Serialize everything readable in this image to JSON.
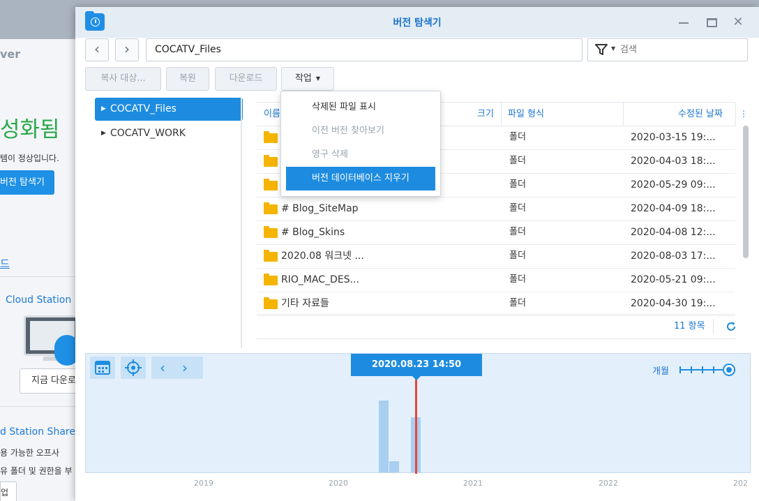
{
  "background_app": {
    "logo_fragment": "ver",
    "status": "성화됨",
    "description": "템이 정상입니다.",
    "open_button": "버전 탐색기",
    "link": "드",
    "cloud_station_title": "Cloud Station",
    "download_button": "지금 다운로",
    "share_title": "d Station Share",
    "share_desc1": "용 가능한 오프사",
    "share_desc2": "유 폴더 및 권한을 부",
    "share_button": "업"
  },
  "window": {
    "title": "버전 탐색기"
  },
  "toolbar": {
    "path": "COCATV_Files",
    "search_placeholder": "검색",
    "copy_to": "복사 대상...",
    "restore": "복원",
    "download": "다운로드",
    "action": "작업"
  },
  "tree": {
    "items": [
      {
        "label": "COCATV_Files",
        "selected": true
      },
      {
        "label": "COCATV_WORK",
        "selected": false
      }
    ]
  },
  "table": {
    "headers": {
      "name": "이름",
      "size": "크기",
      "type": "파일 형식",
      "date": "수정된 날짜"
    },
    "rows": [
      {
        "name": "",
        "type": "폴더",
        "date": "2020-03-15 19:..."
      },
      {
        "name": "",
        "type": "폴더",
        "date": "2020-04-03 18:..."
      },
      {
        "name": "",
        "type": "폴더",
        "date": "2020-05-29 09:..."
      },
      {
        "name": "# Blog_SiteMap",
        "type": "폴더",
        "date": "2020-04-09 18:..."
      },
      {
        "name": "# Blog_Skins",
        "type": "폴더",
        "date": "2020-04-08 12:..."
      },
      {
        "name": "2020.08 워크넷 ...",
        "type": "폴더",
        "date": "2020-08-03 17:..."
      },
      {
        "name": "RIO_MAC_DES...",
        "type": "폴더",
        "date": "2020-05-21 09:..."
      },
      {
        "name": "기타 자료들",
        "type": "폴더",
        "date": "2020-04-30 19:..."
      }
    ],
    "item_count": "11 항목"
  },
  "menu": {
    "items": [
      {
        "label": "삭제된 파일 표시",
        "enabled": true
      },
      {
        "label": "이전 버전 찾아보기",
        "enabled": false
      },
      {
        "label": "영구 삭제",
        "enabled": false
      },
      {
        "label": "버전 데이터베이스 지우기",
        "enabled": true,
        "highlighted": true
      }
    ]
  },
  "timeline": {
    "current": "2020.08.23 14:50",
    "zoom_label": "개월",
    "years": [
      "2019",
      "2020",
      "2021",
      "2022",
      "202"
    ],
    "bars": [
      {
        "year": 2020.28,
        "level": 0.76
      },
      {
        "year": 2020.36,
        "level": 0.12
      },
      {
        "year": 2020.52,
        "level": 0.58
      }
    ]
  },
  "colors": {
    "accent": "#1d8ce0",
    "marker": "#e8453c",
    "folder": "#f5b400"
  }
}
